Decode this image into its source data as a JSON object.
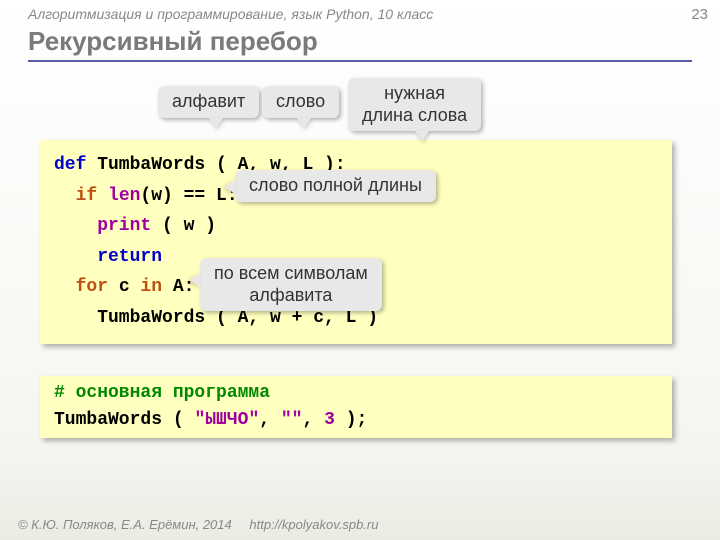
{
  "header": "Алгоритмизация и программирование, язык Python, 10 класс",
  "page_number": "23",
  "title": "Рекурсивный перебор",
  "callouts": {
    "alphabet": "алфавит",
    "word": "слово",
    "length": "нужная\nдлина слова",
    "fullword": "слово полной длины",
    "allchars": "по всем символам\nалфавита"
  },
  "code1": {
    "l1a": "def",
    "l1b": " TumbaWords ( A, w, L ):",
    "l2a": "  if ",
    "l2b": "len",
    "l2c": "(w) == L:",
    "l3a": "    print",
    "l3b": " ( w )",
    "l4": "    return",
    "l5a": "  for",
    "l5b": " c ",
    "l5c": "in",
    "l5d": " A:",
    "l6": "    TumbaWords ( A, w + c, L )"
  },
  "code2": {
    "comment": "# основная программа",
    "call_a": "TumbaWords ( ",
    "str": "\"ЫШЧО\"",
    "call_b": ", ",
    "str2": "\"\"",
    "call_c": ", ",
    "num": "3",
    "call_d": " );"
  },
  "footer": {
    "copyright": "© К.Ю. Поляков, Е.А. Ерёмин, 2014",
    "url": "http://kpolyakov.spb.ru"
  }
}
